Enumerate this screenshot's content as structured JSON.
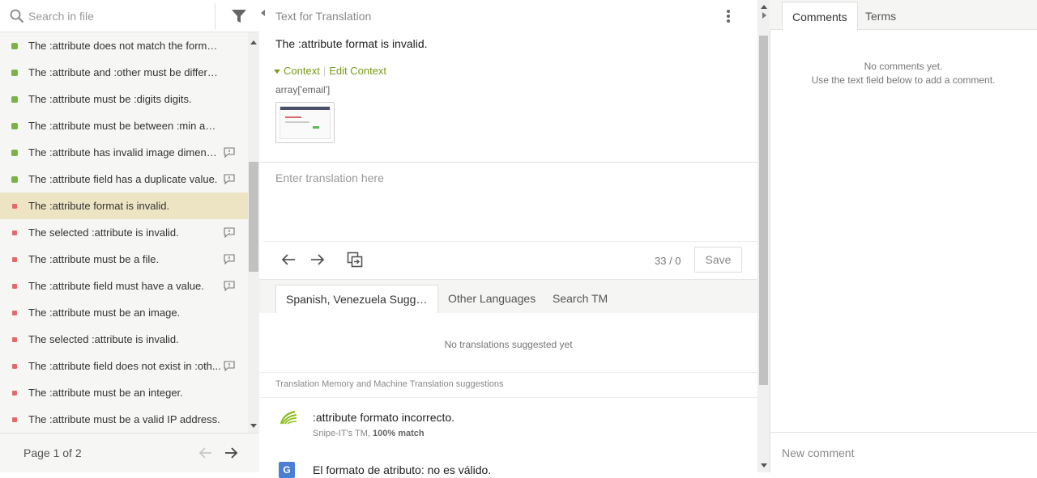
{
  "search": {
    "placeholder": "Search in file"
  },
  "strings": [
    {
      "text": "The :attribute does not match the format :f...",
      "status": "translated",
      "has_comment": false
    },
    {
      "text": "The :attribute and :other must be different.",
      "status": "translated",
      "has_comment": false
    },
    {
      "text": "The :attribute must be :digits digits.",
      "status": "translated",
      "has_comment": false
    },
    {
      "text": "The :attribute must be between :min and :...",
      "status": "translated",
      "has_comment": false
    },
    {
      "text": "The :attribute has invalid image dimensi...",
      "status": "translated",
      "has_comment": true
    },
    {
      "text": "The :attribute field has a duplicate value.",
      "status": "translated",
      "has_comment": true
    },
    {
      "text": "The :attribute format is invalid.",
      "status": "untranslated",
      "has_comment": false,
      "active": true
    },
    {
      "text": "The selected :attribute is invalid.",
      "status": "untranslated",
      "has_comment": true
    },
    {
      "text": "The :attribute must be a file.",
      "status": "untranslated",
      "has_comment": true
    },
    {
      "text": "The :attribute field must have a value.",
      "status": "untranslated",
      "has_comment": true
    },
    {
      "text": "The :attribute must be an image.",
      "status": "untranslated",
      "has_comment": false
    },
    {
      "text": "The selected :attribute is invalid.",
      "status": "untranslated",
      "has_comment": false
    },
    {
      "text": "The :attribute field does not exist in :oth...",
      "status": "untranslated",
      "has_comment": true
    },
    {
      "text": "The :attribute must be an integer.",
      "status": "untranslated",
      "has_comment": false
    },
    {
      "text": "The :attribute must be a valid IP address.",
      "status": "untranslated",
      "has_comment": false
    }
  ],
  "pager": {
    "label": "Page 1 of 2"
  },
  "editor": {
    "header": "Text for Translation",
    "source": "The :attribute format is invalid.",
    "context_label": "Context",
    "edit_context_label": "Edit Context",
    "context_value": "array['email']",
    "translation_placeholder": "Enter translation here",
    "counter": "33 / 0",
    "save_label": "Save"
  },
  "suggestion_tabs": [
    {
      "label": "Spanish, Venezuela Sugges..."
    },
    {
      "label": "Other Languages"
    },
    {
      "label": "Search TM"
    }
  ],
  "suggestions": {
    "empty": "No translations suggested yet",
    "tm_header": "Translation Memory and Machine Translation suggestions",
    "items": [
      {
        "text": ":attribute formato incorrecto.",
        "source": "Snipe-IT's TM,",
        "match": "100% match",
        "icon": "translation-memory-icon"
      },
      {
        "text": "El formato de atributo: no es válido.",
        "icon": "google-translate-icon"
      }
    ]
  },
  "right": {
    "tabs": [
      {
        "label": "Comments"
      },
      {
        "label": "Terms"
      }
    ],
    "empty_line1": "No comments yet.",
    "empty_line2": "Use the text field below to add a comment.",
    "new_comment_placeholder": "New comment"
  },
  "colors": {
    "translated": "#7bb347",
    "untranslated": "#e46a6a",
    "active_row": "#ede4c4",
    "accent": "#7a9a17"
  }
}
